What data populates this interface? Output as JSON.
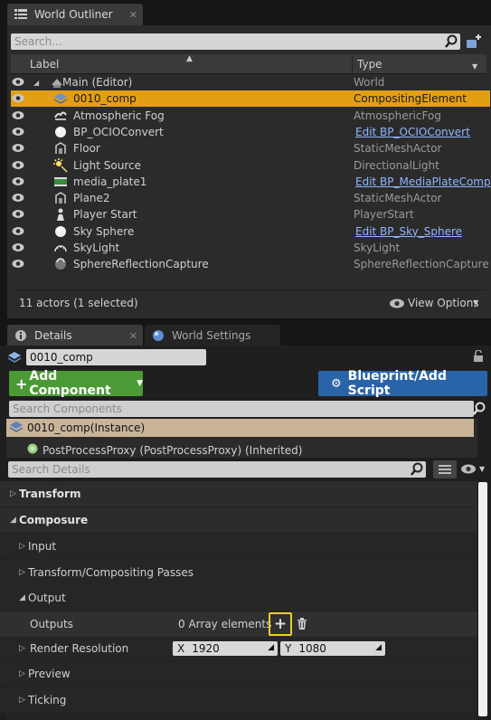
{
  "outliner": {
    "tab_title": "World Outliner",
    "search_placeholder": "Search...",
    "col_label": "Label",
    "col_type": "Type",
    "rows": [
      {
        "label": "Main (Editor)",
        "type": "World",
        "link": false,
        "selected": false,
        "icon": "world-icon"
      },
      {
        "label": "0010_comp",
        "type": "CompositingElement",
        "link": false,
        "selected": true,
        "icon": "layers-icon"
      },
      {
        "label": "Atmospheric Fog",
        "type": "AtmosphericFog",
        "link": false,
        "selected": false,
        "icon": "fog-icon"
      },
      {
        "label": "BP_OCIOConvert",
        "type": "Edit BP_OCIOConvert",
        "link": true,
        "selected": false,
        "icon": "sphere-icon"
      },
      {
        "label": "Floor",
        "type": "StaticMeshActor",
        "link": false,
        "selected": false,
        "icon": "static-mesh-icon"
      },
      {
        "label": "Light Source",
        "type": "DirectionalLight",
        "link": false,
        "selected": false,
        "icon": "light-icon"
      },
      {
        "label": "media_plate1",
        "type": "Edit BP_MediaPlateComp",
        "link": true,
        "selected": false,
        "icon": "media-icon"
      },
      {
        "label": "Plane2",
        "type": "StaticMeshActor",
        "link": false,
        "selected": false,
        "icon": "static-mesh-icon"
      },
      {
        "label": "Player Start",
        "type": "PlayerStart",
        "link": false,
        "selected": false,
        "icon": "player-start-icon"
      },
      {
        "label": "Sky Sphere",
        "type": "Edit BP_Sky_Sphere",
        "link": true,
        "selected": false,
        "icon": "sphere-icon"
      },
      {
        "label": "SkyLight",
        "type": "SkyLight",
        "link": false,
        "selected": false,
        "icon": "skylight-icon"
      },
      {
        "label": "SphereReflectionCapture",
        "type": "SphereReflectionCapture",
        "link": false,
        "selected": false,
        "icon": "reflection-icon"
      }
    ],
    "status": "11 actors (1 selected)",
    "view_options": "View Options"
  },
  "details": {
    "tab_details": "Details",
    "tab_world_settings": "World Settings",
    "actor_name": "0010_comp",
    "add_component": "Add Component",
    "blueprint_button": "Blueprint/Add Script",
    "search_components_placeholder": "Search Components",
    "component_instance": "0010_comp(Instance)",
    "component_child": "PostProcessProxy (PostProcessProxy) (Inherited)",
    "search_details_placeholder": "Search Details",
    "sections": {
      "transform": "Transform",
      "composure": "Composure",
      "input": "Input",
      "transform_passes": "Transform/Compositing Passes",
      "output": "Output",
      "outputs": "Outputs",
      "array_elements": "0 Array elements",
      "render_resolution": "Render Resolution",
      "res_x_label": "X",
      "res_x": "1920",
      "res_y_label": "Y",
      "res_y": "1080",
      "preview": "Preview",
      "ticking": "Ticking"
    }
  },
  "colors": {
    "selection": "#e39f14",
    "add_component_green": "#4b9a35",
    "blueprint_blue": "#2a64a8",
    "link": "#8fb6ff",
    "component_instance_bg": "#c9b49a",
    "highlight_border": "#e8d027"
  }
}
